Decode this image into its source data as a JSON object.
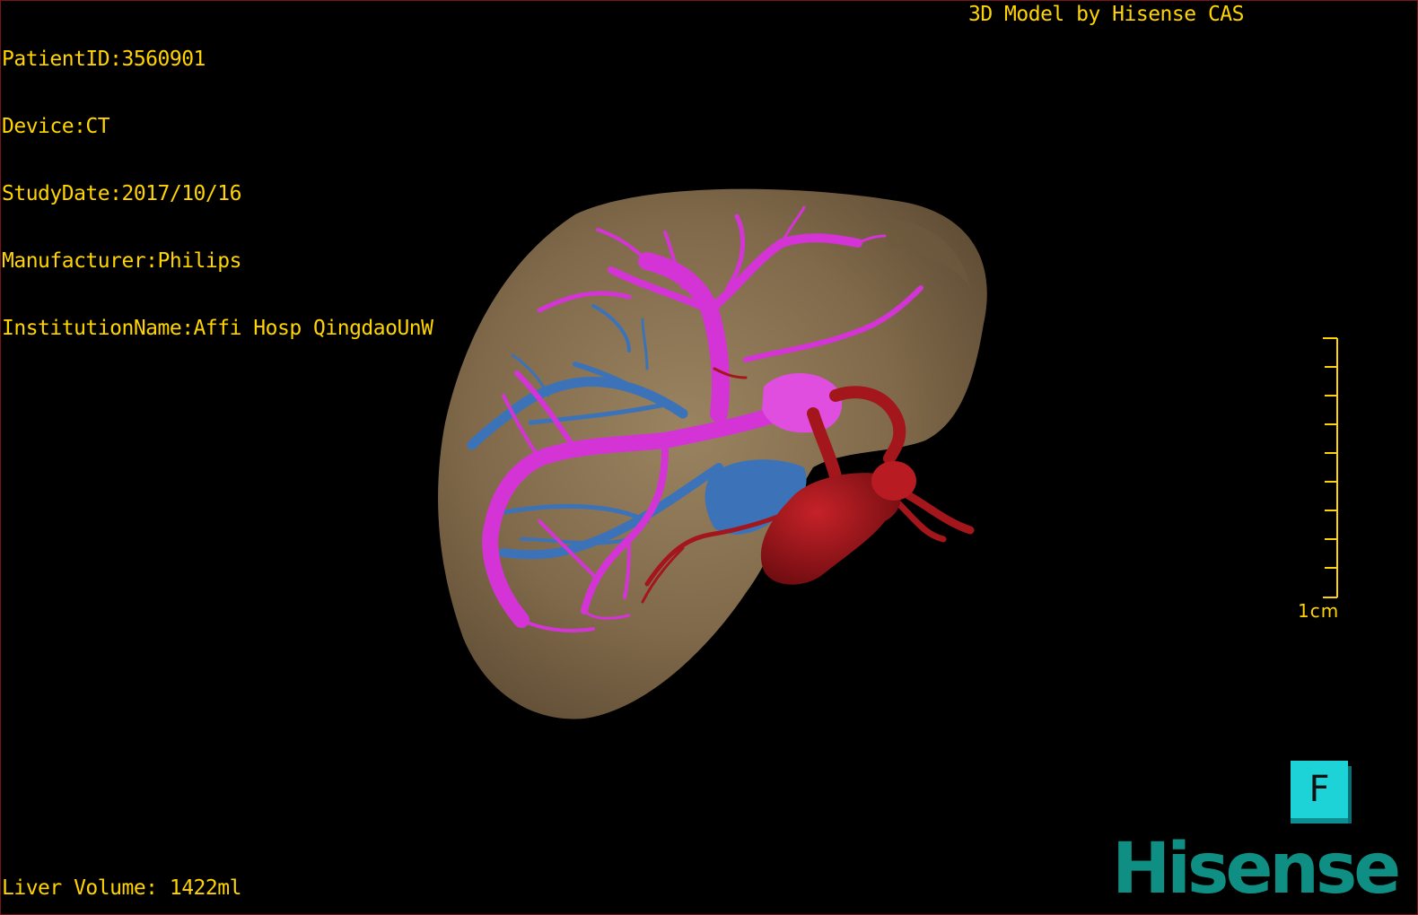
{
  "meta": {
    "patient_id": "PatientID:3560901",
    "device": "Device:CT",
    "study_date": "StudyDate:2017/10/16",
    "manufacturer": "Manufacturer:Philips",
    "institution": "InstitutionName:Affi Hosp QingdaoUnW"
  },
  "header": {
    "model_credit": "3D Model by Hisense CAS"
  },
  "footer": {
    "liver_volume": "Liver Volume: 1422ml"
  },
  "scale": {
    "label": "1cm"
  },
  "orientation": {
    "label": "F"
  },
  "brand": {
    "name": "Hisense"
  },
  "colors": {
    "background": "#000000",
    "overlay_text": "#ffd400",
    "liver": "#8a7452",
    "portal_vein": "#d434d6",
    "hepatic_vein": "#3c73b8",
    "artery": "#a3161c",
    "orientation_cube": "#1ed3d8",
    "brand": "#0f8f84"
  },
  "icons": {
    "orientation_cube": "orientation-cube-icon",
    "scale_bar": "scale-bar-icon"
  }
}
